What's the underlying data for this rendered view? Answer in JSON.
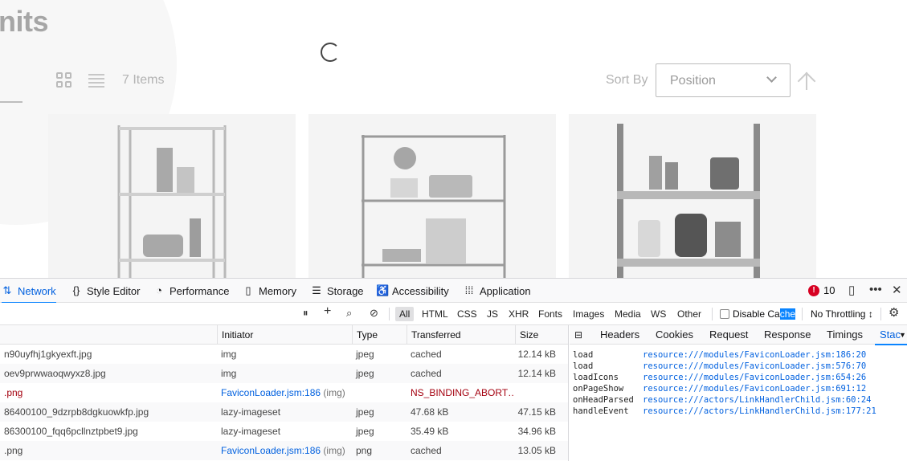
{
  "page": {
    "title_fragment": "nits",
    "items_count": "7 Items",
    "sort_label": "Sort By",
    "sort_value": "Position"
  },
  "devtools": {
    "tabs": [
      {
        "label": "Network",
        "icon": "network-icon",
        "active": true
      },
      {
        "label": "Style Editor",
        "icon": "style-editor-icon"
      },
      {
        "label": "Performance",
        "icon": "performance-icon"
      },
      {
        "label": "Memory",
        "icon": "memory-icon"
      },
      {
        "label": "Storage",
        "icon": "storage-icon"
      },
      {
        "label": "Accessibility",
        "icon": "accessibility-icon"
      },
      {
        "label": "Application",
        "icon": "application-icon"
      }
    ],
    "error_count": "10",
    "filters": [
      "All",
      "HTML",
      "CSS",
      "JS",
      "XHR",
      "Fonts",
      "Images",
      "Media",
      "WS",
      "Other"
    ],
    "disable_cache_prefix": "Disable Ca",
    "disable_cache_selected": "che",
    "throttling": "No Throttling ↕",
    "columns": [
      "Initiator",
      "Type",
      "Transferred",
      "Size"
    ],
    "requests": [
      {
        "file": "n90uyfhj1gkyexft.jpg",
        "initiator": "img",
        "initiator_extra": "",
        "type": "jpeg",
        "transferred": "cached",
        "size": "12.14 kB"
      },
      {
        "file": "oev9prwwaoqwyxz8.jpg",
        "initiator": "img",
        "initiator_extra": "",
        "type": "jpeg",
        "transferred": "cached",
        "size": "12.14 kB"
      },
      {
        "file": ".png",
        "initiator": "FaviconLoader.jsm:186",
        "initiator_extra": "(img)",
        "type": "",
        "transferred": "NS_BINDING_ABORT…",
        "size": "",
        "error": true
      },
      {
        "file": "86400100_9dzrpb8dgkuowkfp.jpg",
        "initiator": "lazy-imageset",
        "initiator_extra": "",
        "type": "jpeg",
        "transferred": "47.68 kB",
        "size": "47.15 kB"
      },
      {
        "file": "86300100_fqq6pcllnztpbet9.jpg",
        "initiator": "lazy-imageset",
        "initiator_extra": "",
        "type": "jpeg",
        "transferred": "35.49 kB",
        "size": "34.96 kB"
      },
      {
        "file": ".png",
        "initiator": "FaviconLoader.jsm:186",
        "initiator_extra": "(img)",
        "type": "png",
        "transferred": "cached",
        "size": "13.05 kB"
      }
    ],
    "side_tabs": [
      "Headers",
      "Cookies",
      "Request",
      "Response",
      "Timings",
      "Stac"
    ],
    "stack": [
      {
        "fn": "load",
        "src": "resource:///modules/FaviconLoader.jsm:186:20"
      },
      {
        "fn": "load",
        "src": "resource:///modules/FaviconLoader.jsm:576:70"
      },
      {
        "fn": "loadIcons",
        "src": "resource:///modules/FaviconLoader.jsm:654:26"
      },
      {
        "fn": "onPageShow",
        "src": "resource:///modules/FaviconLoader.jsm:691:12"
      },
      {
        "fn": "onHeadParsed",
        "src": "resource:///actors/LinkHandlerChild.jsm:60:24"
      },
      {
        "fn": "handleEvent",
        "src": "resource:///actors/LinkHandlerChild.jsm:177:21"
      }
    ]
  }
}
